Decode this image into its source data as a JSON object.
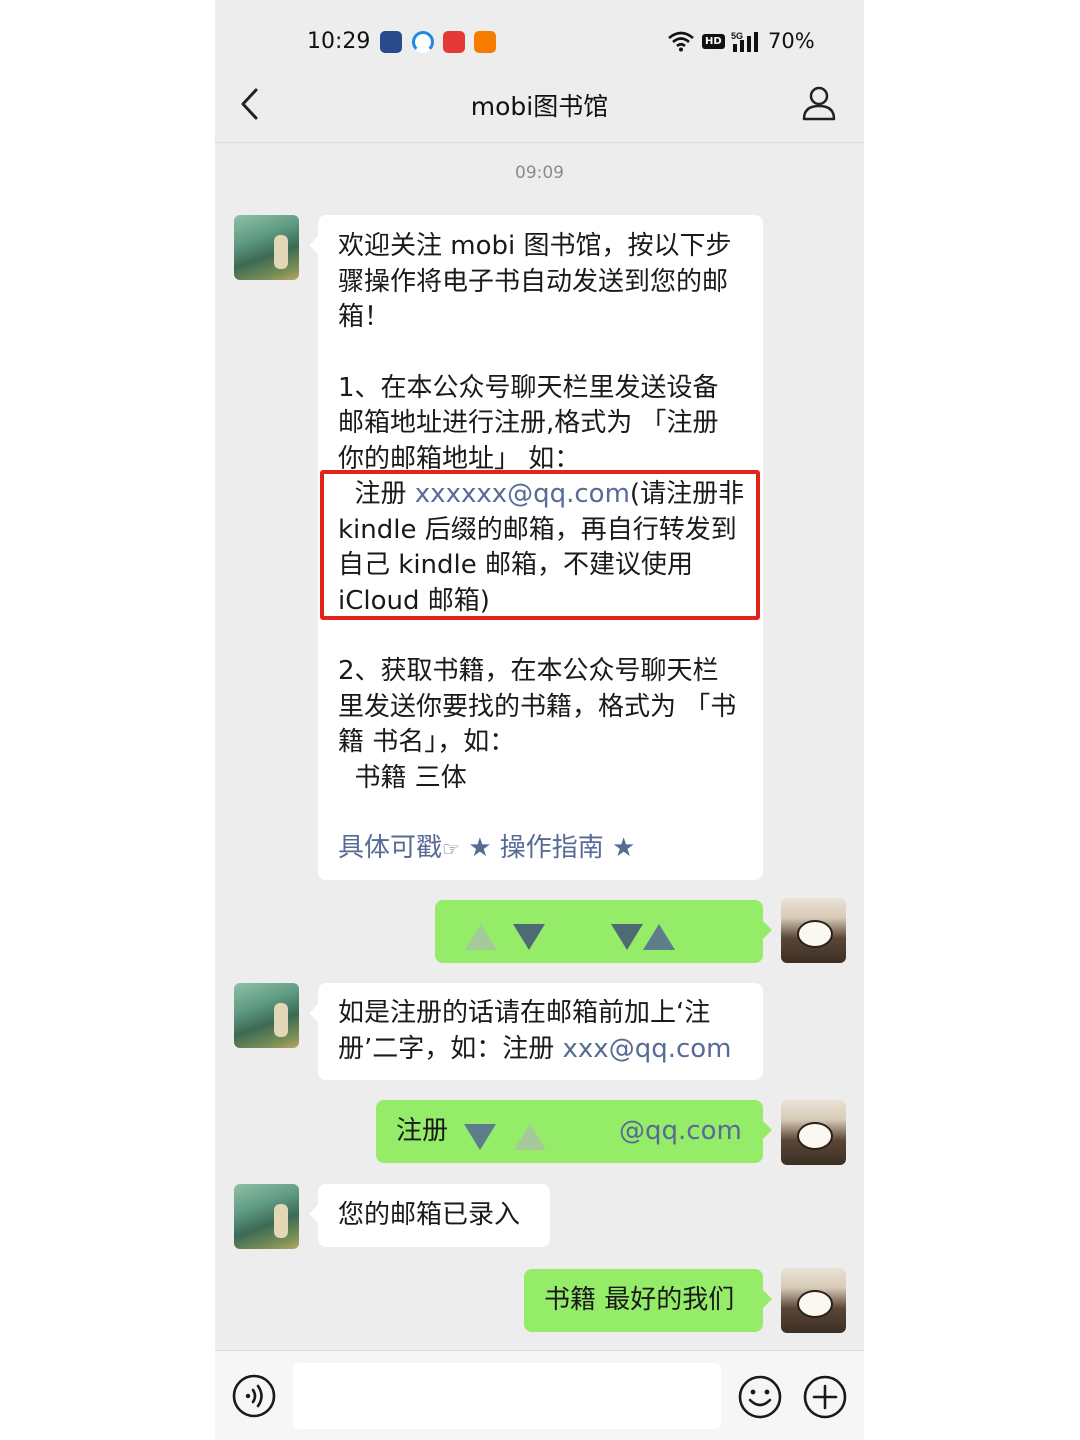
{
  "status_bar": {
    "time": "10:29",
    "battery": "70%",
    "network": "5G",
    "hd_badge": "HD",
    "app_icons": [
      "app-icon-1",
      "app-icon-2",
      "app-icon-3",
      "app-icon-4"
    ]
  },
  "nav": {
    "title": "mobi图书馆",
    "back_icon": "chevron-left-icon",
    "profile_icon": "person-icon"
  },
  "timestamp": "09:09",
  "messages": [
    {
      "from": "official",
      "intro": "欢迎关注 mobi 图书馆，按以下步\n骤操作将电子书自动发送到您的邮\n箱！",
      "step1": "1、在本公众号聊天栏里发送设备\n邮箱地址进行注册,格式为 「注册\n你的邮箱地址」 如：",
      "step1_example_prefix": "  注册 ",
      "step1_example_email": "xxxxxx@qq.com",
      "step1_example_note": "(请注册非\nkindle 后缀的邮箱，再自行转发到\n自己 kindle 邮箱，不建议使用\niCloud 邮箱)",
      "step2": "2、获取书籍，在本公众号聊天栏\n里发送你要找的书籍，格式为 「书\n籍 书名」，如：\n  书籍 三体",
      "guide_prefix": "具体可戳",
      "guide_hand": "☞",
      "guide_link": "★ 操作指南 ★"
    },
    {
      "from": "user",
      "text": ""
    },
    {
      "from": "official",
      "text_prefix": "如是注册的话请在邮箱前加上‘注\n册’二字，如：注册 ",
      "text_email": "xxx@qq.com"
    },
    {
      "from": "user",
      "prefix": "注册",
      "suffix": "@qq.com"
    },
    {
      "from": "official",
      "text": "您的邮箱已录入"
    },
    {
      "from": "user",
      "text": "书籍 最好的我们"
    }
  ],
  "input_bar": {
    "voice_icon": "voice-icon",
    "emoji_icon": "emoji-icon",
    "plus_icon": "plus-icon"
  },
  "colors": {
    "outgoing_bubble": "#95ec69",
    "incoming_bubble": "#ffffff",
    "background": "#ededed",
    "link": "#576b95",
    "highlight_box": "#e2231a"
  }
}
